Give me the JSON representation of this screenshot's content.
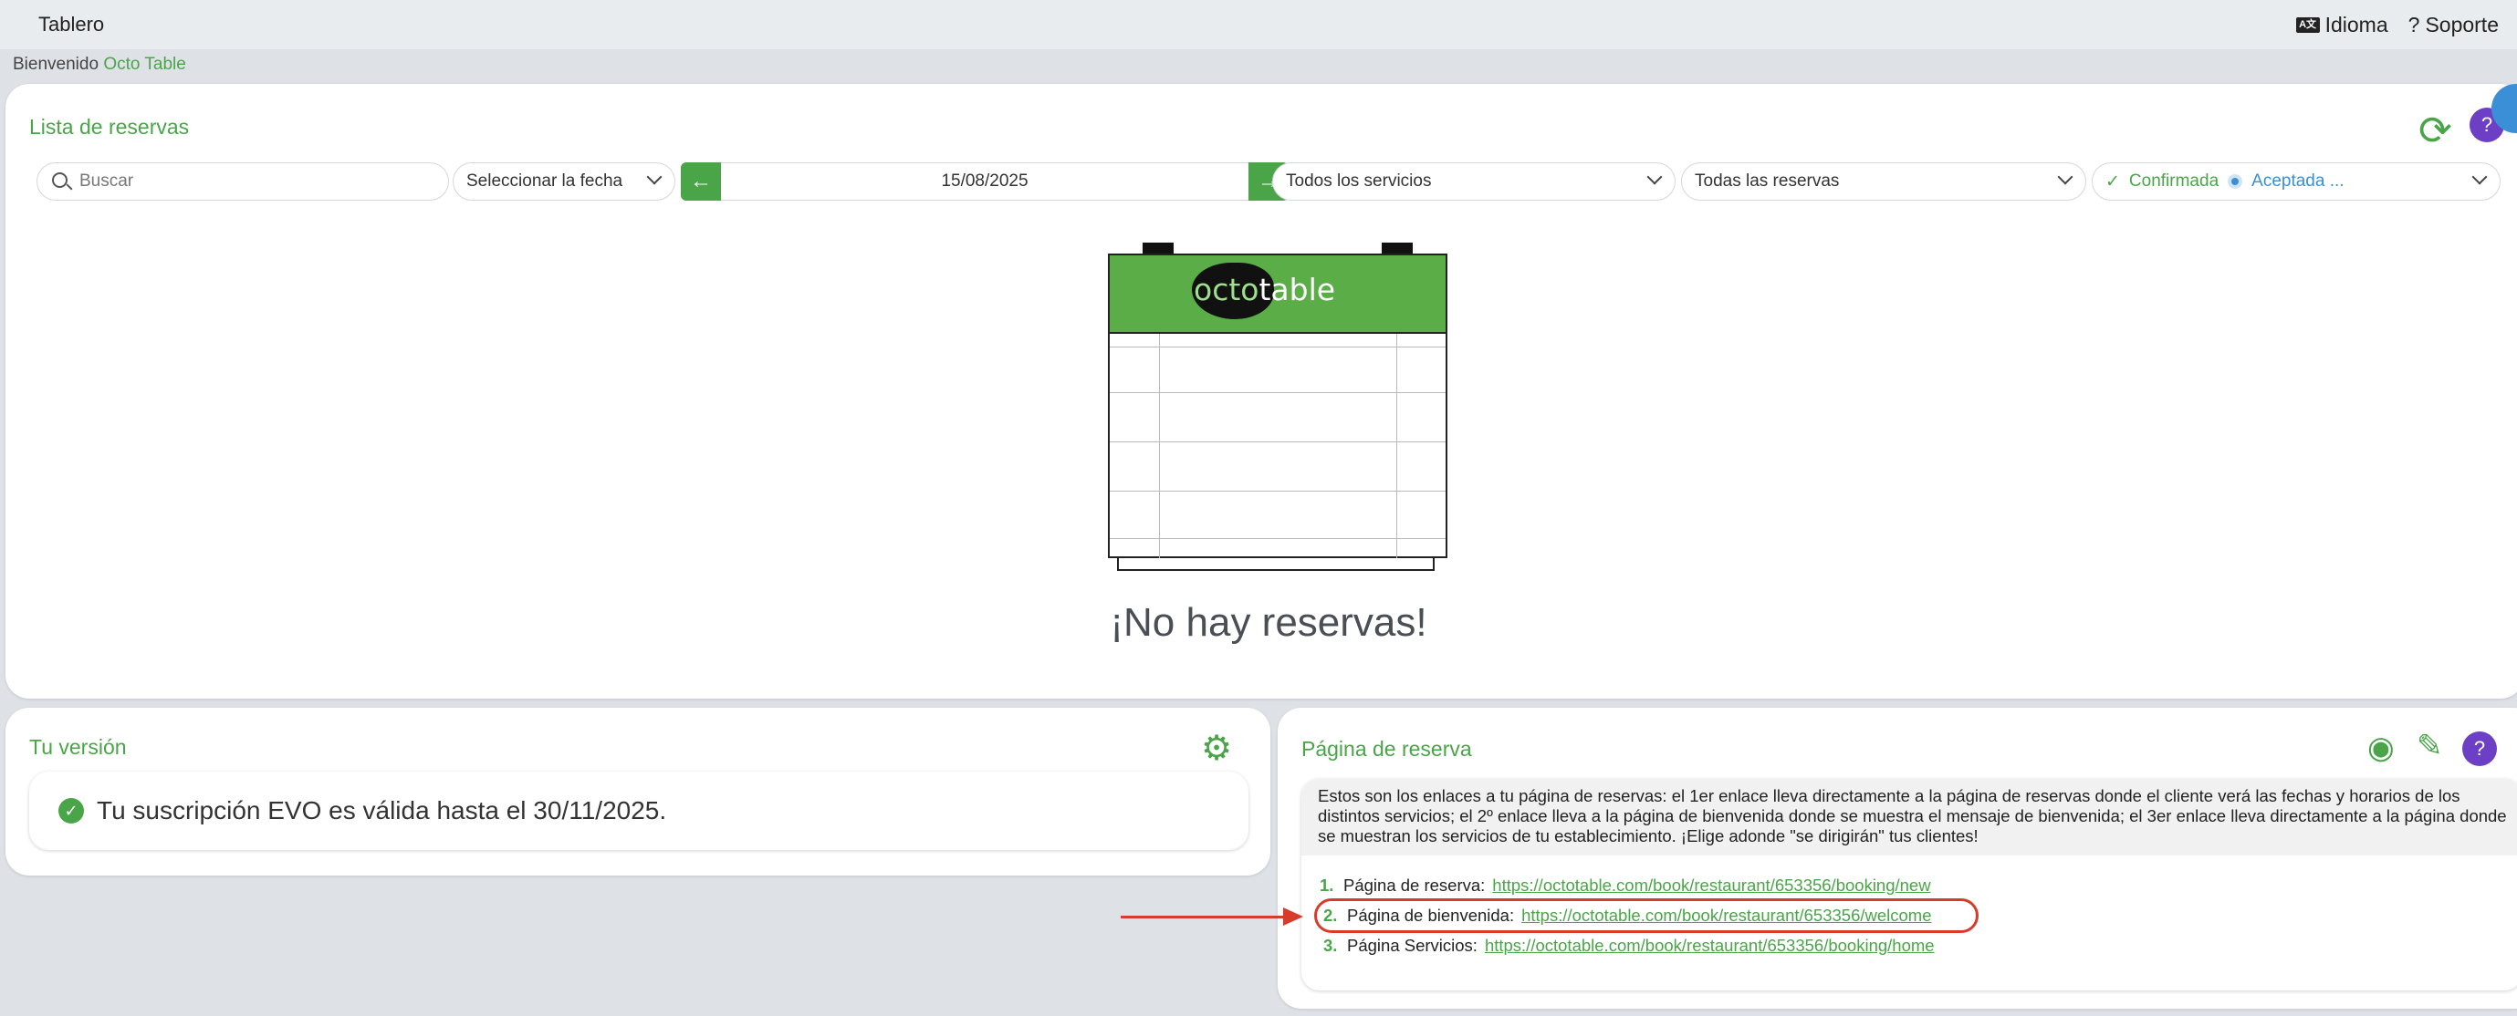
{
  "topbar": {
    "title": "Tablero",
    "language": "Idioma",
    "support": "Soporte",
    "language_icon": "language-icon",
    "support_icon": "question-icon"
  },
  "welcome": {
    "prefix": "Bienvenido",
    "name": "Octo Table"
  },
  "reservations": {
    "title": "Lista de reservas",
    "search_placeholder": "Buscar",
    "date_select": "Seleccionar la fecha",
    "date": "15/08/2025",
    "services": "Todos los servicios",
    "reservation_filter": "Todas las reservas",
    "status_confirmed": "Confirmada",
    "status_accepted": "Aceptada ...",
    "empty_message": "¡No hay reservas!",
    "logo_octo": "octo",
    "logo_table": "table"
  },
  "version": {
    "title": "Tu versión",
    "subscription": "Tu suscripción EVO es válida hasta el 30/11/2025."
  },
  "booking": {
    "title": "Página de reserva",
    "description": "Estos son los enlaces a tu página de reservas: el 1er enlace lleva directamente a la página de reservas donde el cliente verá las fechas y horarios de los distintos servicios; el 2º enlace lleva a la página de bienvenida donde se muestra el mensaje de bienvenida; el 3er enlace lleva directamente a la página donde se muestran los servicios de tu establecimiento. ¡Elige adonde \"se dirigirán\" tus clientes!",
    "links": [
      {
        "num": "1.",
        "label": "Página de reserva:",
        "url": "https://octotable.com/book/restaurant/653356/booking/new"
      },
      {
        "num": "2.",
        "label": "Página de bienvenida:",
        "url": "https://octotable.com/book/restaurant/653356/welcome"
      },
      {
        "num": "3.",
        "label": "Página Servicios:",
        "url": "https://octotable.com/book/restaurant/653356/booking/home"
      }
    ]
  },
  "colors": {
    "accent": "#4aa548",
    "help": "#6c3fc4",
    "annotation": "#d73b2a",
    "info": "#3a8fd6"
  }
}
